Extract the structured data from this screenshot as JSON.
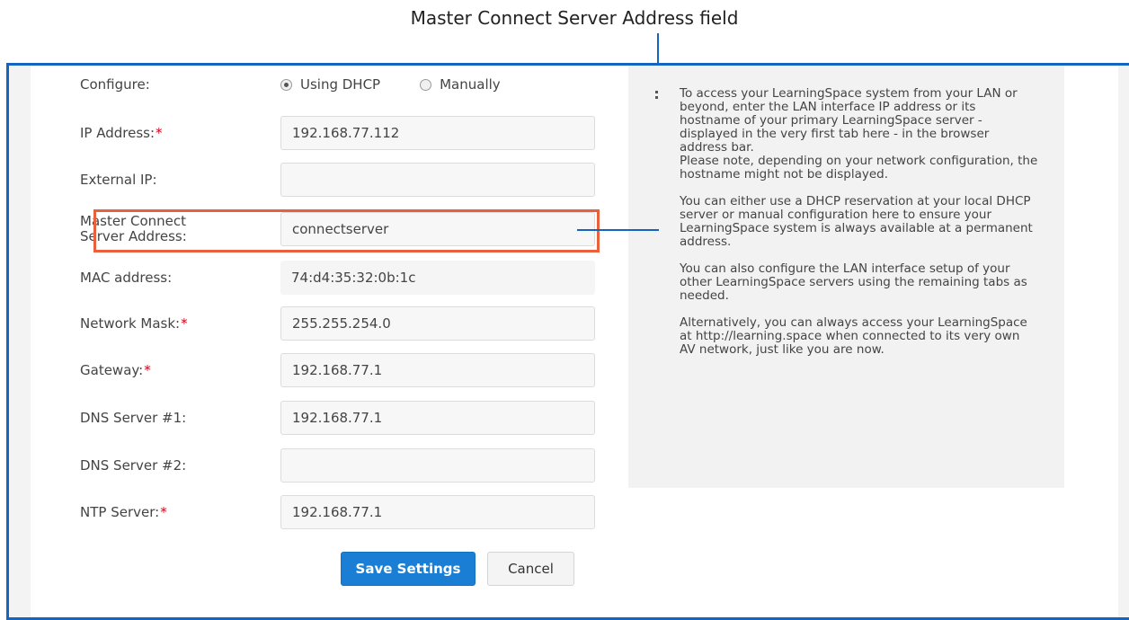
{
  "callout": {
    "title": "Master Connect Server Address field"
  },
  "form": {
    "configure": {
      "label": "Configure:",
      "options": [
        "Using DHCP",
        "Manually"
      ],
      "selected": "Using DHCP"
    },
    "ip": {
      "label": "IP Address:",
      "required_mark": "*",
      "value": "192.168.77.112"
    },
    "external_ip": {
      "label": "External IP:",
      "value": ""
    },
    "master_connect": {
      "label_line1": "Master Connect",
      "label_line2": "Server Address:",
      "value": "connectserver"
    },
    "mac": {
      "label": "MAC address:",
      "value": "74:d4:35:32:0b:1c"
    },
    "mask": {
      "label": "Network Mask:",
      "required_mark": "*",
      "value": "255.255.254.0"
    },
    "gateway": {
      "label": "Gateway:",
      "required_mark": "*",
      "value": "192.168.77.1"
    },
    "dns1": {
      "label": "DNS Server #1:",
      "value": "192.168.77.1"
    },
    "dns2": {
      "label": "DNS Server #2:",
      "value": ""
    },
    "ntp": {
      "label": "NTP Server:",
      "required_mark": "*",
      "value": "192.168.77.1"
    },
    "save_label": "Save Settings",
    "cancel_label": "Cancel"
  },
  "help": {
    "paragraphs": [
      "To access your LearningSpace system from your LAN or beyond, enter the LAN interface IP address or its hostname of your primary LearningSpace server - displayed in the very first tab here - in the browser address bar.",
      "Please note, depending on your network configuration, the hostname might not be displayed.",
      "You can either use a DHCP reservation at your local DHCP server or manual configuration here to ensure your LearningSpace system is always available at a permanent address.",
      "You can also configure the LAN interface setup of your other LearningSpace servers using the remaining tabs as needed.",
      "Alternatively, you can always access your LearningSpace at http://learning.space when connected to its very own AV network, just like you are now."
    ]
  },
  "colors": {
    "frame": "#1565c0",
    "highlight": "#e8603c",
    "primary_button": "#1a7fd4",
    "required": "#d0021b"
  }
}
